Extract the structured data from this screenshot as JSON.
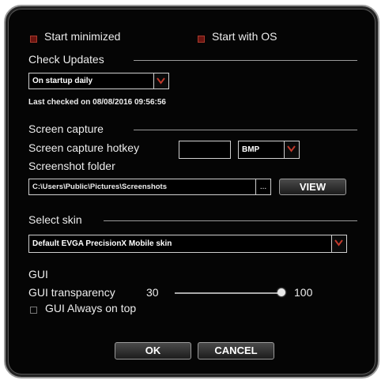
{
  "startup": {
    "start_minimized": {
      "label": "Start minimized",
      "checked": true
    },
    "start_with_os": {
      "label": "Start with OS",
      "checked": true
    }
  },
  "updates": {
    "section_title": "Check Updates",
    "frequency": "On startup daily",
    "last_checked": "Last checked on 08/08/2016 09:56:56"
  },
  "screen_capture": {
    "section_title": "Screen capture",
    "hotkey_label": "Screen capture hotkey",
    "hotkey_value": "",
    "format": "BMP",
    "folder_label": "Screenshot folder",
    "folder_path": "C:\\Users\\Public\\Pictures\\Screenshots",
    "browse_label": "...",
    "view_label": "VIEW"
  },
  "skin": {
    "section_title": "Select skin",
    "selected": "Default EVGA PrecisionX Mobile skin"
  },
  "gui": {
    "section_title": "GUI",
    "transparency_label": "GUI transparency",
    "transparency_min": "30",
    "transparency_max": "100",
    "transparency_value": 100,
    "always_on_top": {
      "label": "GUI Always on top",
      "checked": false
    }
  },
  "buttons": {
    "ok": "OK",
    "cancel": "CANCEL"
  },
  "colors": {
    "checked_box": "#6a1410",
    "dropdown_arrow": "#c0392b",
    "window_bg": "#050505"
  }
}
